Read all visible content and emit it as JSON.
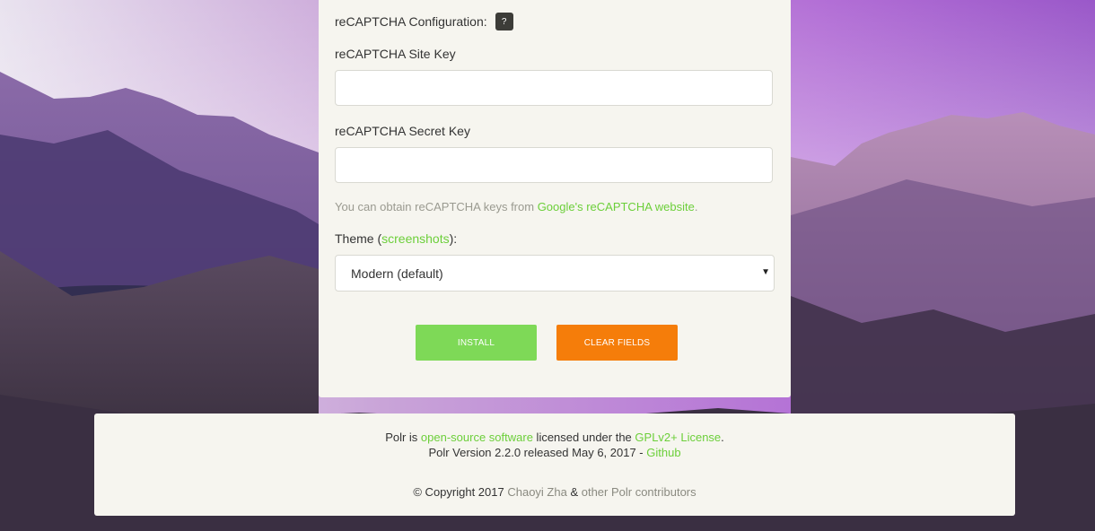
{
  "form": {
    "recaptcha_config_label": "reCAPTCHA Configuration:",
    "help_label": "?",
    "site_key_label": "reCAPTCHA Site Key",
    "site_key_value": "",
    "secret_key_label": "reCAPTCHA Secret Key",
    "secret_key_value": "",
    "note_prefix": "You can obtain reCAPTCHA keys from ",
    "note_link": "Google's reCAPTCHA website",
    "note_suffix": ".",
    "theme_label_prefix": "Theme (",
    "theme_link": "screenshots",
    "theme_label_suffix": "):",
    "theme_selected": "Modern (default)",
    "caret": "▼",
    "install_label": "INSTALL",
    "clear_label": "CLEAR FIELDS"
  },
  "footer": {
    "line1_prefix": "Polr is ",
    "line1_link1": "open-source software",
    "line1_mid": " licensed under the ",
    "line1_link2": "GPLv2+ License",
    "line1_suffix": ".",
    "line2_prefix": "Polr Version 2.2.0 released May 6, 2017 - ",
    "line2_link": "Github",
    "line3_prefix": "© Copyright 2017 ",
    "line3_link1": "Chaoyi Zha",
    "line3_mid": " & ",
    "line3_link2": "other Polr contributors"
  },
  "colors": {
    "accent_green": "#7ed957",
    "link_green": "#6ccf3a",
    "accent_orange": "#f57d0a",
    "panel_bg": "#f6f5ef"
  }
}
